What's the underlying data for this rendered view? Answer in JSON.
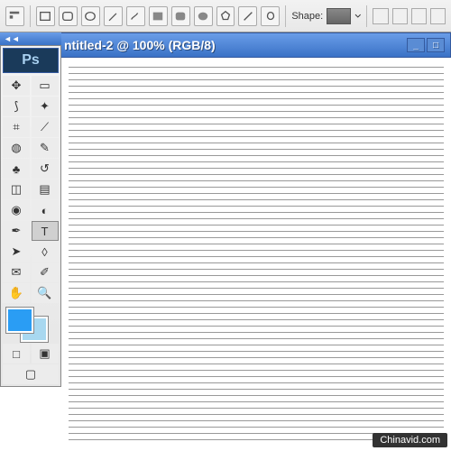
{
  "options": {
    "shape_label": "Shape:"
  },
  "titlebar": {
    "title": "ntitled-2 @ 100% (RGB/8)",
    "min": "_",
    "max": "□"
  },
  "toolbox": {
    "collapse": "◄◄",
    "logo": "Ps",
    "tools": [
      {
        "name": "move-tool",
        "glyph": "✥"
      },
      {
        "name": "marquee-tool",
        "glyph": "▭"
      },
      {
        "name": "lasso-tool",
        "glyph": "⟆"
      },
      {
        "name": "wand-tool",
        "glyph": "✦"
      },
      {
        "name": "crop-tool",
        "glyph": "⌗"
      },
      {
        "name": "slice-tool",
        "glyph": "⟋"
      },
      {
        "name": "healing-tool",
        "glyph": "◍"
      },
      {
        "name": "brush-tool",
        "glyph": "✎"
      },
      {
        "name": "stamp-tool",
        "glyph": "♣"
      },
      {
        "name": "history-brush-tool",
        "glyph": "↺"
      },
      {
        "name": "eraser-tool",
        "glyph": "◫"
      },
      {
        "name": "gradient-tool",
        "glyph": "▤"
      },
      {
        "name": "blur-tool",
        "glyph": "◉"
      },
      {
        "name": "dodge-tool",
        "glyph": "◐"
      },
      {
        "name": "pen-tool",
        "glyph": "✒"
      },
      {
        "name": "type-tool",
        "glyph": "T"
      },
      {
        "name": "path-select-tool",
        "glyph": "➤"
      },
      {
        "name": "shape-tool",
        "glyph": "◊"
      },
      {
        "name": "notes-tool",
        "glyph": "✉"
      },
      {
        "name": "eyedropper-tool",
        "glyph": "✐"
      },
      {
        "name": "hand-tool",
        "glyph": "✋"
      },
      {
        "name": "zoom-tool",
        "glyph": "🔍"
      }
    ],
    "colors": {
      "foreground": "#2a9df4",
      "background": "#a8d8f0"
    },
    "mode_btns": [
      "□",
      "▣"
    ]
  },
  "watermark": "Chinavid.com"
}
